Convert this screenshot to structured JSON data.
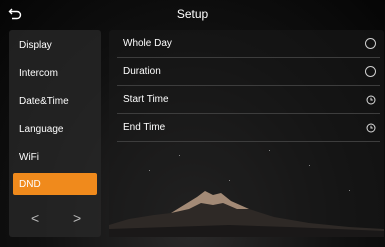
{
  "header": {
    "title": "Setup",
    "back_icon": "back-arrow-icon"
  },
  "sidebar": {
    "items": [
      {
        "label": "Display"
      },
      {
        "label": "Intercom"
      },
      {
        "label": "Date&Time"
      },
      {
        "label": "Language"
      },
      {
        "label": "WiFi"
      },
      {
        "label": "DND",
        "active": true
      }
    ],
    "prev_arrow": "<",
    "next_arrow": ">"
  },
  "panel": {
    "rows": [
      {
        "label": "Whole Day",
        "control": "radio-icon"
      },
      {
        "label": "Duration",
        "control": "radio-icon"
      },
      {
        "label": "Start Time",
        "control": "clock-icon"
      },
      {
        "label": "End Time",
        "control": "clock-icon"
      }
    ]
  },
  "colors": {
    "accent": "#f08a1c",
    "background": "#000000"
  }
}
